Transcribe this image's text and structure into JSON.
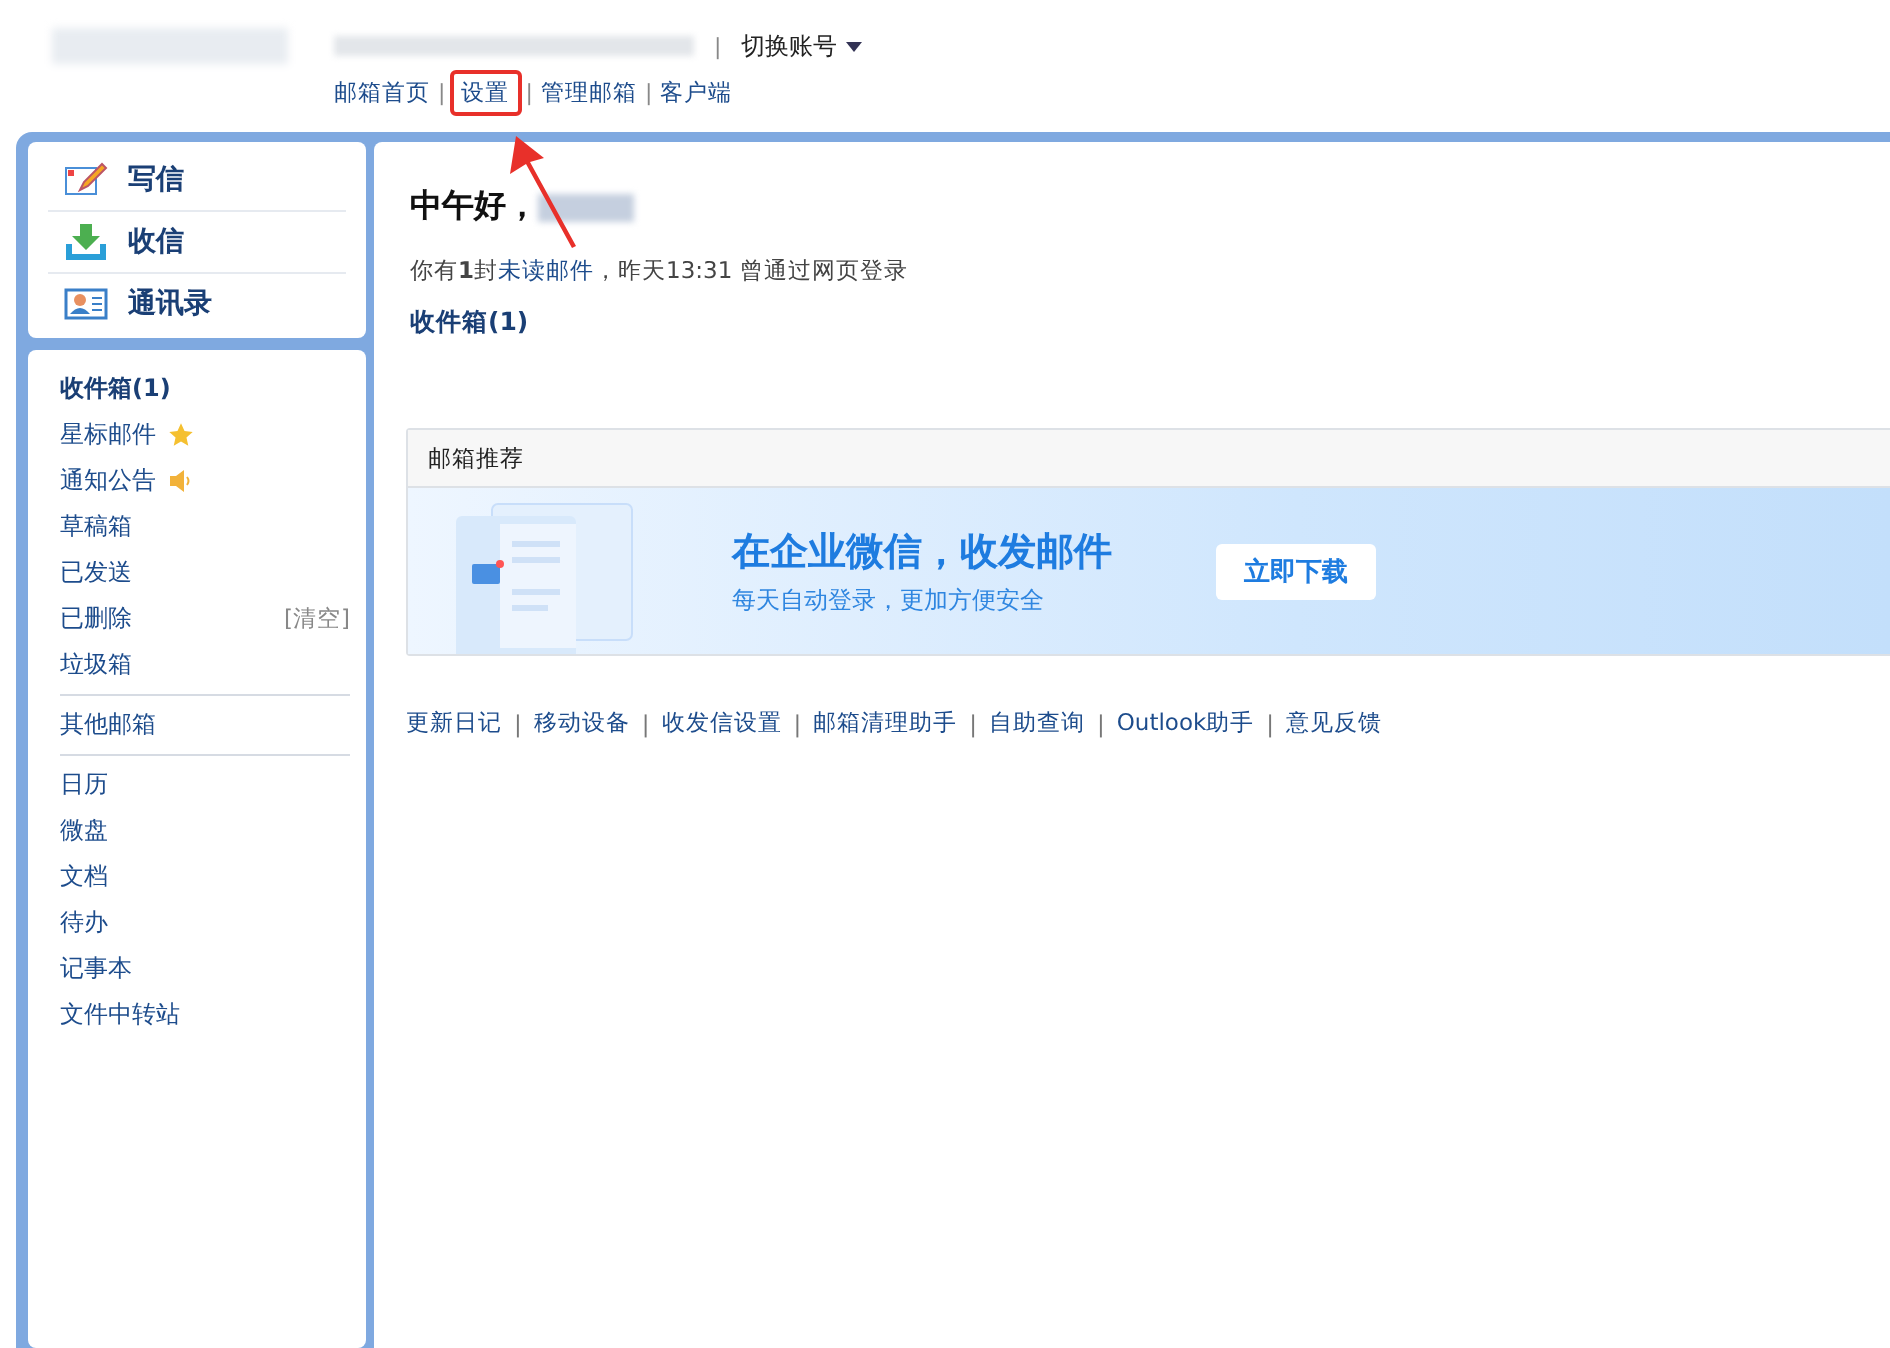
{
  "header": {
    "separator": "|",
    "switch_account": "切换账号",
    "nav_links": [
      {
        "label": "邮箱首页",
        "highlighted": false
      },
      {
        "label": "设置",
        "highlighted": true
      },
      {
        "label": "管理邮箱",
        "highlighted": false
      },
      {
        "label": "客户端",
        "highlighted": false
      }
    ]
  },
  "quick_actions": [
    {
      "kind": "compose",
      "label": "写信"
    },
    {
      "kind": "receive",
      "label": "收信"
    },
    {
      "kind": "contacts",
      "label": "通讯录"
    }
  ],
  "folder_groups": [
    [
      {
        "label": "收件箱(1)",
        "unread": true
      },
      {
        "label": "星标邮件",
        "unread": false,
        "kind": "star"
      },
      {
        "label": "通知公告",
        "unread": false,
        "kind": "speaker"
      },
      {
        "label": "草稿箱",
        "unread": false
      },
      {
        "label": "已发送",
        "unread": false
      },
      {
        "label": "已删除",
        "unread": false,
        "action": "[清空]"
      },
      {
        "label": "垃圾箱",
        "unread": false
      }
    ],
    [
      {
        "label": "其他邮箱",
        "unread": false
      }
    ],
    [
      {
        "label": "日历",
        "unread": false
      },
      {
        "label": "微盘",
        "unread": false
      },
      {
        "label": "文档",
        "unread": false
      },
      {
        "label": "待办",
        "unread": false
      },
      {
        "label": "记事本",
        "unread": false
      },
      {
        "label": "文件中转站",
        "unread": false
      }
    ]
  ],
  "greeting": "中午好，",
  "login_info": {
    "prefix": "你有",
    "count": "1",
    "unit": "封",
    "link": "未读邮件",
    "rest": "，昨天13:31 曾通过网页登录"
  },
  "inbox_link": "收件箱(1)",
  "recommend": {
    "title": "邮箱推荐",
    "headline": "在企业微信，收发邮件",
    "subline": "每天自动登录，更加方便安全",
    "button": "立即下载"
  },
  "footer_links": [
    "更新日记",
    "移动设备",
    "收发信设置",
    "邮箱清理助手",
    "自助查询",
    "Outlook助手",
    "意见反馈"
  ]
}
